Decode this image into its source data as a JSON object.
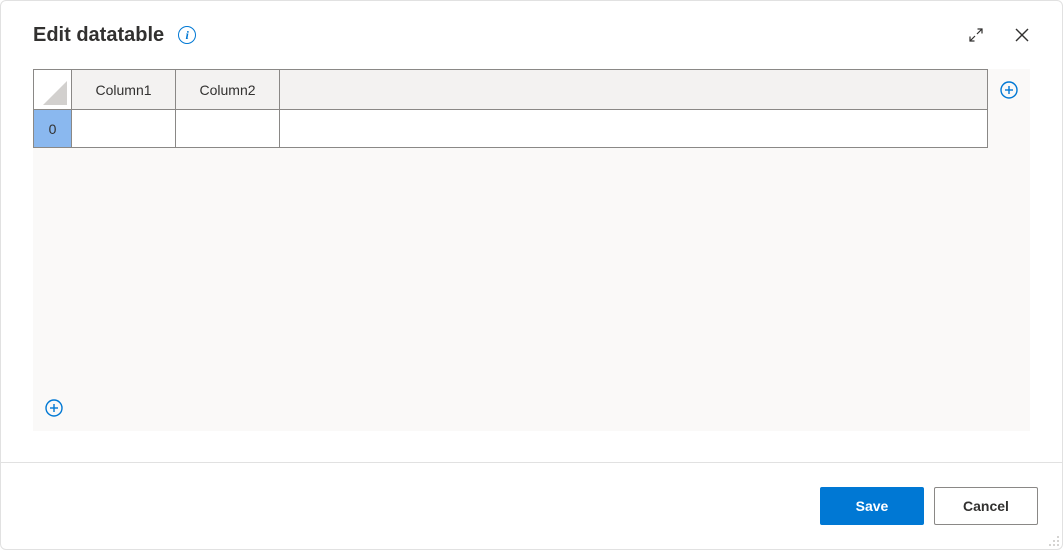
{
  "dialog": {
    "title": "Edit datatable"
  },
  "table": {
    "columns": [
      "Column1",
      "Column2"
    ],
    "rows": [
      {
        "index": "0",
        "cells": [
          "",
          ""
        ]
      }
    ]
  },
  "footer": {
    "save_label": "Save",
    "cancel_label": "Cancel"
  }
}
